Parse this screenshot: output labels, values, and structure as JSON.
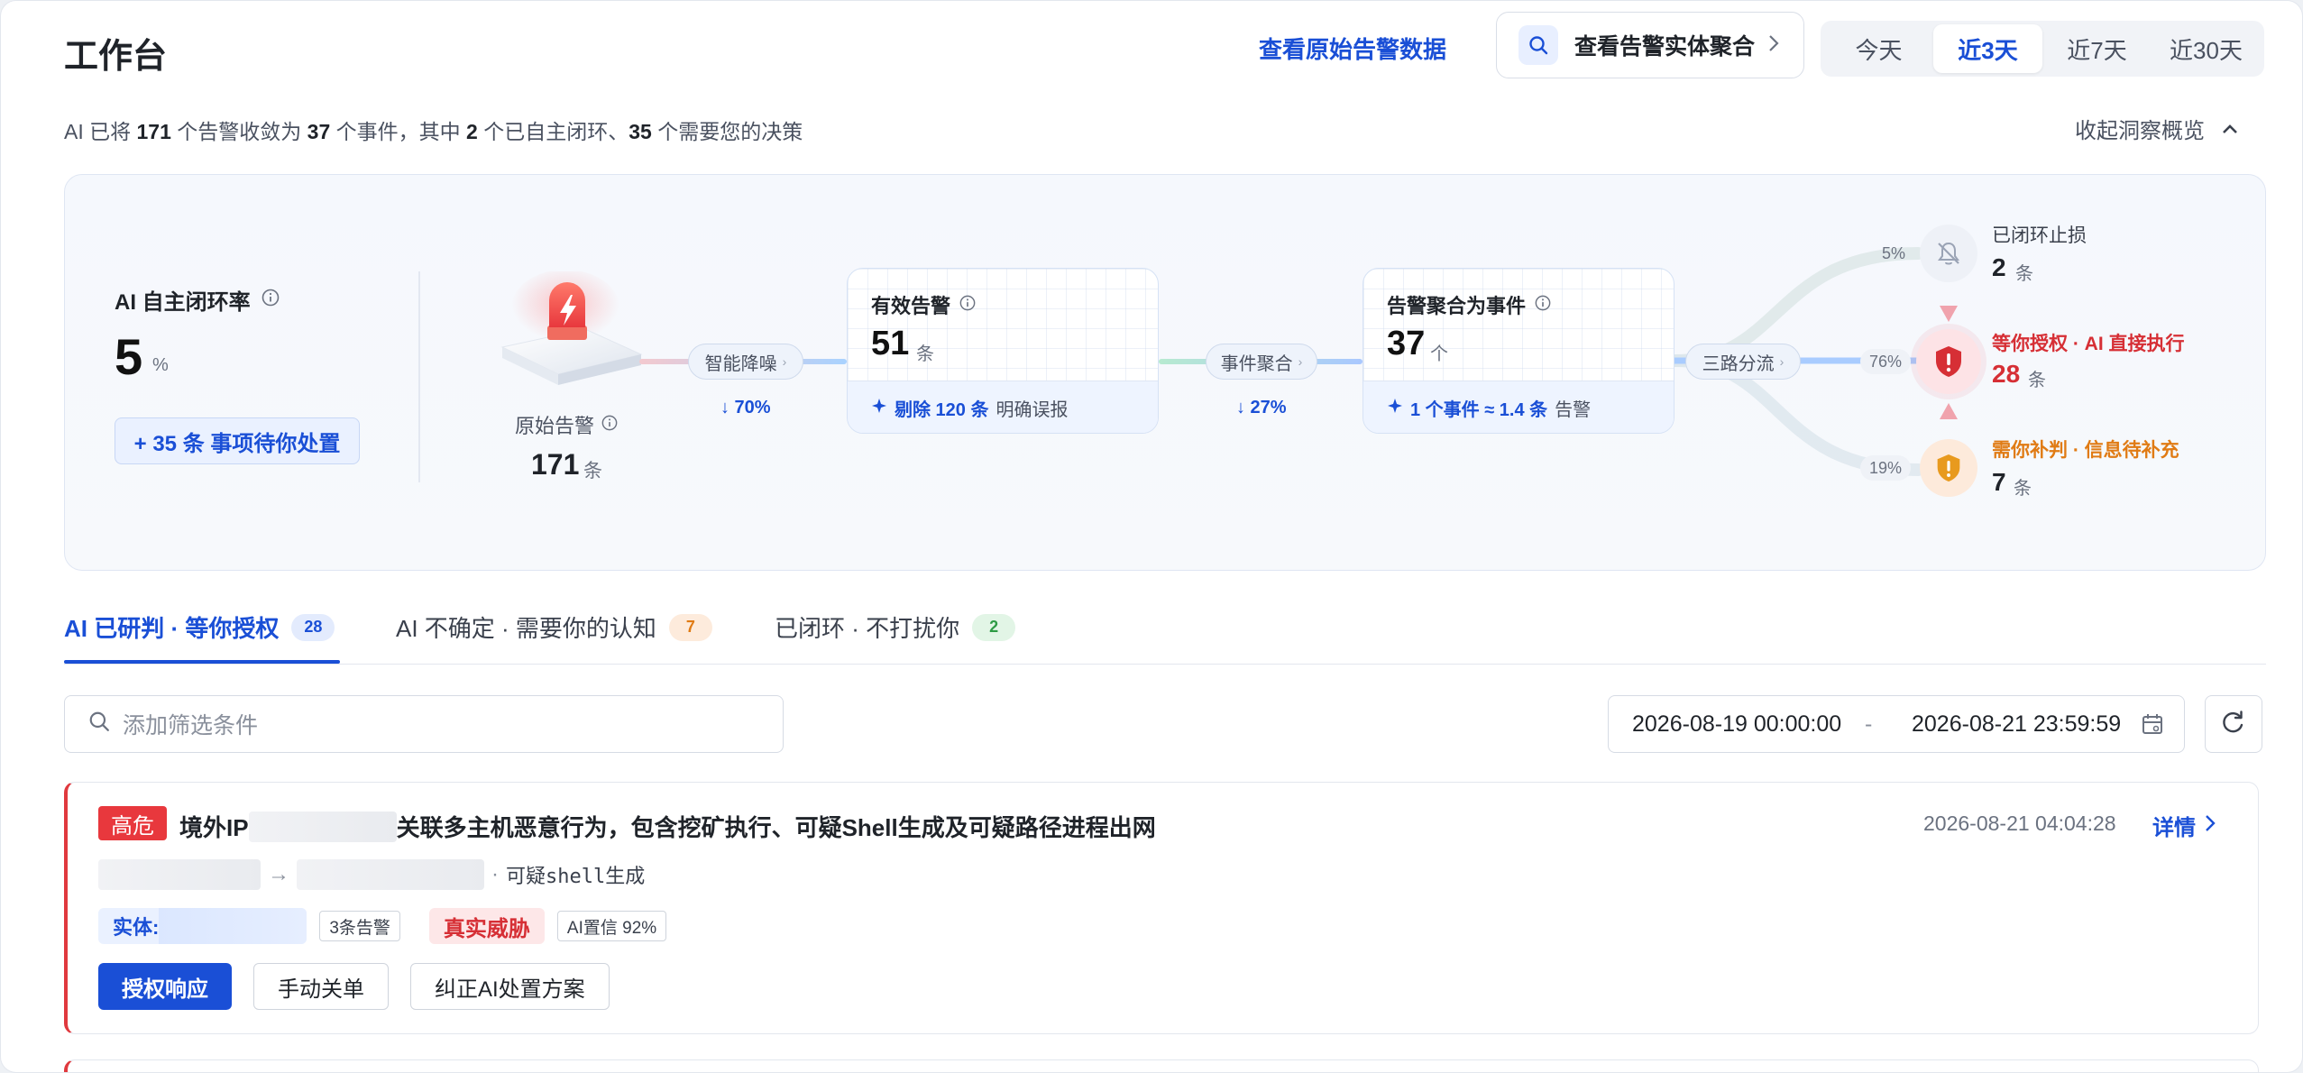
{
  "header": {
    "title": "工作台",
    "raw_link": "查看原始告警数据",
    "entity_button": "查看告警实体聚合",
    "ranges": [
      "今天",
      "近3天",
      "近7天",
      "近30天"
    ],
    "active_range": "近3天"
  },
  "summary": {
    "p1": "AI 已将 ",
    "alerts": "171",
    "p2": " 个告警收敛为 ",
    "events": "37",
    "p3": " 个事件，其中 ",
    "closed": "2",
    "p4": " 个已自主闭环、",
    "decisions": "35",
    "p5": " 个需要您的决策",
    "collapse": "收起洞察概览"
  },
  "overview": {
    "rate_label": "AI 自主闭环率",
    "rate_value": "5",
    "rate_unit": "%",
    "pending": "+ 35 条 事项待你处置",
    "raw_label": "原始告警",
    "raw_value": "171",
    "raw_unit": "条",
    "denoise_pill": "智能降噪",
    "denoise_drop": "↓ 70%",
    "aggregate_pill": "事件聚合",
    "aggregate_drop": "↓ 27%",
    "split_pill": "三路分流",
    "effective": {
      "title": "有效告警",
      "value": "51",
      "unit": "条",
      "foot_bold": "剔除 120 条",
      "foot_text": "明确误报"
    },
    "events": {
      "title": "告警聚合为事件",
      "value": "37",
      "unit": "个",
      "foot_bold": "1 个事件 ≈ 1.4 条",
      "foot_text": "告警"
    },
    "outcomes": [
      {
        "pct": "5%",
        "title": "已闭环止损",
        "value": "2",
        "unit": "条",
        "color": "#1f2329"
      },
      {
        "pct": "76%",
        "title": "等你授权 · AI 直接执行",
        "value": "28",
        "unit": "条",
        "color": "#d62f35"
      },
      {
        "pct": "19%",
        "title": "需你补判 · 信息待补充",
        "value": "7",
        "unit": "条",
        "color": "#e07b14"
      }
    ]
  },
  "tabs": [
    {
      "label": "AI 已研判 · 等你授权",
      "count": "28"
    },
    {
      "label": "AI 不确定 · 需要你的认知",
      "count": "7"
    },
    {
      "label": "已闭环 · 不打扰你",
      "count": "2"
    }
  ],
  "filter": {
    "placeholder": "添加筛选条件",
    "date_start": "2026-08-19 00:00:00",
    "date_sep": "-",
    "date_end": "2026-08-21 23:59:59"
  },
  "alert": {
    "severity": "高危",
    "title_prefix": "境外IP",
    "title_suffix": "关联多主机恶意行为，包含挖矿执行、可疑Shell生成及可疑路径进程出网",
    "time": "2026-08-21 04:04:28",
    "detail": "详情",
    "path_arrow": "→",
    "path_dot": "·",
    "path_text": "可疑shell生成",
    "entity_label": "实体:",
    "alerts_tag": "3条告警",
    "threat_tag": "真实威胁",
    "confidence_tag": "AI置信 92%",
    "actions": [
      "授权响应",
      "手动关单",
      "纠正AI处置方案"
    ]
  },
  "colors": {
    "primary": "#1a4fd6",
    "danger": "#e8383d",
    "warning": "#e07b14"
  }
}
